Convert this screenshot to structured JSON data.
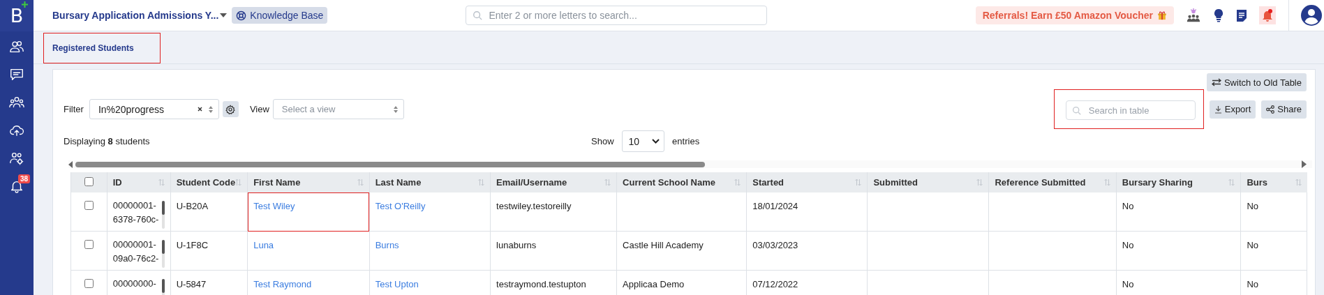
{
  "app_header": {
    "logo": "B",
    "workspace": "Bursary Application Admissions Y...",
    "knowledge_base": "Knowledge Base",
    "search": {
      "placeholder": "Enter 2 or more letters to search..."
    },
    "referral": "Referrals! Earn £50 Amazon Voucher",
    "notifications_unread": true
  },
  "sidebar": {
    "notification_count": "38"
  },
  "tabs": [
    {
      "label": "Registered Students",
      "selected": true,
      "highlighted": true
    }
  ],
  "toolbar": {
    "switch_button": "Switch to Old Table",
    "filter_label": "Filter",
    "filter_value": "In%20progress",
    "view_label": "View",
    "view_placeholder": "Select a view",
    "search": {
      "placeholder": "Search in table",
      "highlighted": true
    },
    "export": "Export",
    "share": "Share",
    "count_text": "Displaying **8** students",
    "show_label": "Show",
    "page_size": "10",
    "entries_label": "entries"
  },
  "table": {
    "all_checked": false,
    "columns": [
      {
        "label": "ID",
        "kind": "id"
      },
      {
        "label": "Student Code",
        "kind": "text"
      },
      {
        "label": "First Name",
        "kind": "link"
      },
      {
        "label": "Last Name",
        "kind": "link"
      },
      {
        "label": "Email/Username",
        "kind": "text"
      },
      {
        "label": "Current School Name",
        "kind": "text"
      },
      {
        "label": "Started",
        "kind": "text"
      },
      {
        "label": "Submitted",
        "kind": "text"
      },
      {
        "label": "Reference Submitted",
        "kind": "text"
      },
      {
        "label": "Bursary Sharing",
        "kind": "text"
      },
      {
        "label": "Burs",
        "kind": "text"
      }
    ],
    "rows": [
      {
        "checked": false,
        "cells": [
          "00000001-6378-760c-",
          "U-B20A",
          {
            "text": "Test Wiley",
            "highlighted": true
          },
          "Test O'Reilly",
          "testwiley.testoreilly",
          "",
          "18/01/2024",
          "",
          "",
          "No",
          "No"
        ]
      },
      {
        "checked": false,
        "cells": [
          "00000001-09a0-76c2-",
          "U-1F8C",
          "Luna",
          "Burns",
          "lunaburns",
          "Castle Hill Academy",
          "03/03/2023",
          "",
          "",
          "No",
          "No"
        ]
      },
      {
        "checked": false,
        "cells": [
          "00000000-",
          "U-5847",
          "Test Raymond",
          "Test Upton",
          "testraymond.testupton",
          "Applicaa Demo",
          "07/12/2022",
          "",
          "",
          "No",
          "No"
        ]
      }
    ]
  }
}
